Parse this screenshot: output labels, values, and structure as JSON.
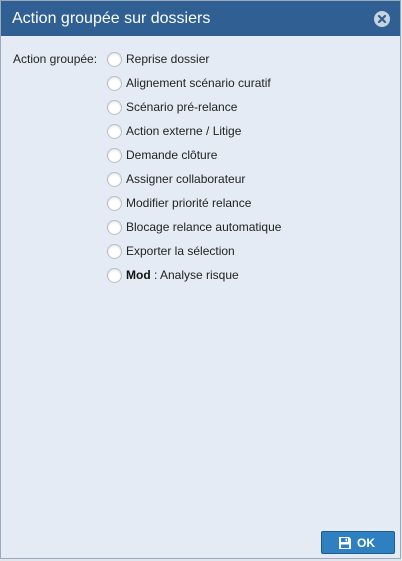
{
  "dialog": {
    "title": "Action groupée sur dossiers",
    "close_icon": "close-circle-icon"
  },
  "form": {
    "label": "Action groupée:",
    "options": [
      {
        "label": "Reprise dossier",
        "checked": false
      },
      {
        "label": "Alignement scénario curatif",
        "checked": false
      },
      {
        "label": "Scénario pré-relance",
        "checked": false
      },
      {
        "label": "Action externe / Litige",
        "checked": false
      },
      {
        "label": "Demande clôture",
        "checked": false
      },
      {
        "label": "Assigner collaborateur",
        "checked": false
      },
      {
        "label": "Modifier priorité relance",
        "checked": false
      },
      {
        "label": "Blocage relance automatique",
        "checked": false
      },
      {
        "label": "Exporter la sélection",
        "checked": false
      },
      {
        "label_bold": "Mod",
        "label_rest": " : Analyse risque",
        "checked": false
      }
    ]
  },
  "footer": {
    "ok_label": "OK",
    "ok_icon": "save-icon"
  },
  "colors": {
    "titlebar": "#2f5f93",
    "body": "#e4ebf4",
    "ok_button": "#2f80c0"
  }
}
